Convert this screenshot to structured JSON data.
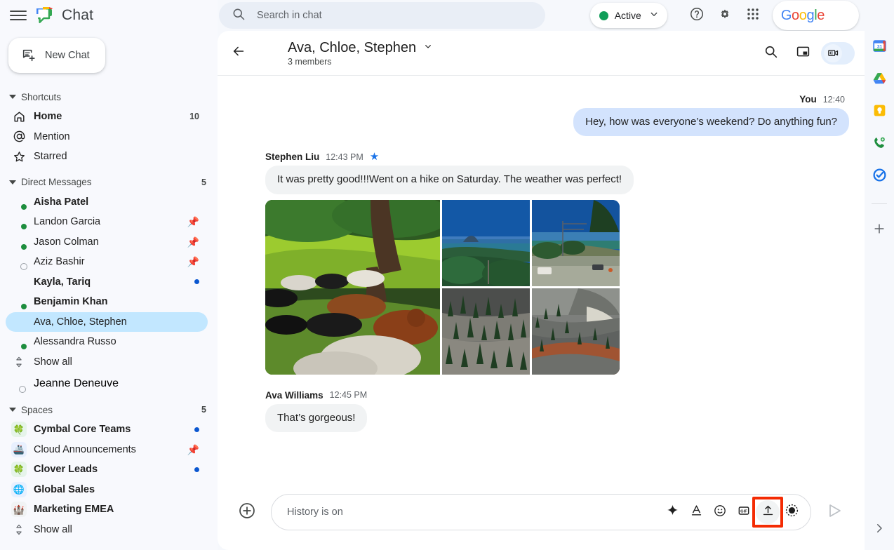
{
  "app": {
    "title": "Chat",
    "logo_icon": "google-chat-logo",
    "menu_icon": "hamburger-menu-icon"
  },
  "new_chat": {
    "label": "New Chat",
    "icon": "new-chat-icon"
  },
  "search": {
    "placeholder": "Search in chat",
    "value": "",
    "icon": "search-icon"
  },
  "status": {
    "label": "Active",
    "color": "#0f9d58",
    "chevron": "chevron-down-icon"
  },
  "topbar": {
    "help_icon": "help-icon",
    "settings_icon": "gear-icon",
    "apps_icon": "apps-grid-icon",
    "brand": "Google",
    "avatar": "user-avatar"
  },
  "sidebar": {
    "sections": [
      {
        "title": "Shortcuts",
        "count": "",
        "items": [
          {
            "label": "Home",
            "icon": "home-icon",
            "bold": true,
            "trailing": "10"
          },
          {
            "label": "Mention",
            "icon": "mention-icon",
            "bold": false,
            "trailing": ""
          },
          {
            "label": "Starred",
            "icon": "star-outline-icon",
            "bold": false,
            "trailing": ""
          }
        ]
      },
      {
        "title": "Direct Messages",
        "count": "5",
        "items": [
          {
            "label": "Aisha Patel",
            "bold": true,
            "presence": "active",
            "trailing": ""
          },
          {
            "label": "Landon Garcia",
            "bold": false,
            "presence": "active",
            "trailing": "pin"
          },
          {
            "label": "Jason Colman",
            "bold": false,
            "presence": "active",
            "trailing": "pin"
          },
          {
            "label": "Aziz Bashir",
            "bold": false,
            "presence": "away",
            "trailing": "pin"
          },
          {
            "label": "Kayla, Tariq",
            "bold": true,
            "presence": "none",
            "trailing": "dot"
          },
          {
            "label": "Benjamin Khan",
            "bold": true,
            "presence": "active",
            "trailing": ""
          },
          {
            "label": "Ava, Chloe, Stephen",
            "bold": false,
            "presence": "none",
            "trailing": "",
            "selected": true
          },
          {
            "label": "Alessandra Russo",
            "bold": false,
            "presence": "active",
            "trailing": ""
          }
        ],
        "show_all": "Show all"
      },
      {
        "title": "Spaces",
        "count": "5",
        "items": [
          {
            "label": "Cymbal Core Teams",
            "emoji": "🍀",
            "bg": "#e6f4ea",
            "bold": true,
            "trailing": "dot"
          },
          {
            "label": "Cloud Announcements",
            "emoji": "🚢",
            "bg": "#e8f0fe",
            "bold": false,
            "trailing": "pin"
          },
          {
            "label": "Clover Leads",
            "emoji": "🍀",
            "bg": "#e6f4ea",
            "bold": true,
            "trailing": "dot"
          },
          {
            "label": "Global Sales",
            "emoji": "🌐",
            "bg": "#e8f0fe",
            "bold": true,
            "trailing": ""
          },
          {
            "label": "Marketing EMEA",
            "emoji": "🏰",
            "bg": "#f1f3f4",
            "bold": true,
            "trailing": ""
          }
        ],
        "show_all": "Show all"
      }
    ],
    "standalone_user": {
      "label": "Jeanne Deneuve",
      "presence": "away"
    }
  },
  "conversation": {
    "back_icon": "back-arrow-icon",
    "title": "Ava, Chloe, Stephen",
    "title_chevron": "chevron-down-icon",
    "subtitle": "3 members",
    "actions": {
      "search_icon": "search-icon",
      "pip_icon": "picture-in-picture-icon",
      "video_call_icon": "video-call-icon"
    },
    "messages": [
      {
        "direction": "outgoing",
        "author": "You",
        "time": "12:40",
        "text": "Hey, how was everyone’s weekend? Do anything fun?"
      },
      {
        "direction": "incoming",
        "author": "Stephen Liu",
        "time": "12:43 PM",
        "starred": true,
        "star_icon": "star-filled-icon",
        "text": "It was pretty good!!!Went on a hike on Saturday. The weather was perfect!",
        "attachments": {
          "type": "photo-grid",
          "count": 5,
          "captions": [
            "cows resting under a large tree in green pasture",
            "coastal bay with island hill under blue sky",
            "roadside view with power lines and ocean",
            "columnar pine trees on grey volcanic soil",
            "red-and-grey volcanic terrain with pine trees"
          ]
        }
      },
      {
        "direction": "incoming",
        "author": "Ava Williams",
        "time": "12:45 PM",
        "starred": false,
        "text": "That’s gorgeous!"
      }
    ]
  },
  "composer": {
    "plus_icon": "add-icon",
    "placeholder": "History is on",
    "value": "",
    "buttons": [
      {
        "name": "gemini-sparkle-icon",
        "label": ""
      },
      {
        "name": "format-text-icon",
        "label": ""
      },
      {
        "name": "emoji-icon",
        "label": ""
      },
      {
        "name": "gif-icon",
        "label": "GIF"
      },
      {
        "name": "upload-file-icon",
        "label": "",
        "highlighted": true
      },
      {
        "name": "record-video-icon",
        "label": ""
      }
    ],
    "send_icon": "send-icon",
    "highlight_color": "#f42b03"
  },
  "right_rail": {
    "items": [
      {
        "name": "google-calendar-icon",
        "label": "Calendar"
      },
      {
        "name": "google-drive-icon",
        "label": "Drive"
      },
      {
        "name": "google-keep-icon",
        "label": "Keep"
      },
      {
        "name": "google-voice-icon",
        "label": "Voice"
      },
      {
        "name": "google-tasks-icon",
        "label": "Tasks"
      }
    ],
    "add_icon": "plus-icon",
    "expand_icon": "chevron-right-icon"
  }
}
